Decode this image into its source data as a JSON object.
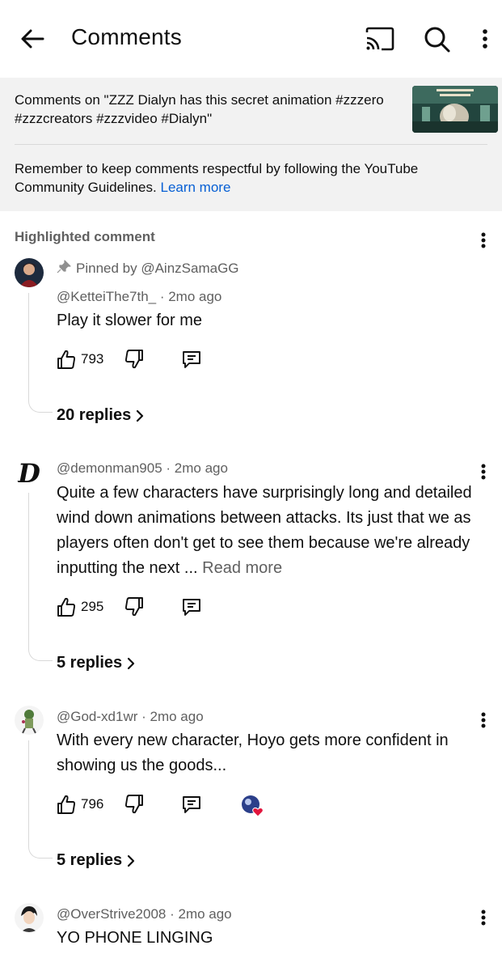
{
  "header": {
    "title": "Comments",
    "icons": [
      "back-arrow-icon",
      "cast-icon",
      "search-icon",
      "more-vert-icon"
    ]
  },
  "context": {
    "video_title": "Comments on \"ZZZ Dialyn has this secret animation #zzzero #zzzcreators  #zzzvideo #Dialyn\"",
    "guidelines_text": "Remember to keep comments respectful by following the YouTube Community Guidelines.",
    "learn_more": "Learn more"
  },
  "highlighted_label": "Highlighted comment",
  "comments": [
    {
      "pinned_by": "Pinned by @AinzSamaGG",
      "author": "@KetteiThe7th_",
      "time": "2mo ago",
      "text": "Play it slower for me",
      "likes": "793",
      "replies": "20 replies"
    },
    {
      "author": "@demonman905",
      "time": "2mo ago",
      "text": "Quite a few characters have surprisingly long and detailed wind down animations between attacks.  Its just that we as players often don't get to see them because we're already inputting the next ...",
      "read_more": "Read more",
      "likes": "295",
      "replies": "5 replies"
    },
    {
      "author": "@God-xd1wr",
      "time": "2mo ago",
      "text": "With every new character, Hoyo gets more confident in showing us the goods...",
      "likes": "796",
      "creator_heart": true,
      "replies": "5 replies"
    },
    {
      "author": "@OverStrive2008",
      "time": "2mo ago",
      "text": "YO PHONE LINGING"
    }
  ],
  "colors": {
    "link": "#065fd4",
    "secondary_text": "#606060",
    "context_bg": "#f2f2f2",
    "heart": "#e2143c"
  }
}
